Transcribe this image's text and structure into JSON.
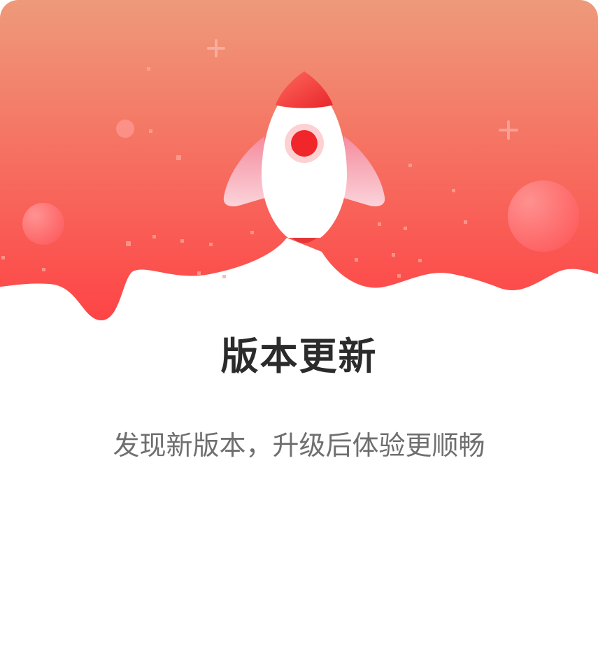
{
  "dialog": {
    "title": "版本更新",
    "message": "发现新版本，升级后体验更顺畅"
  },
  "hero": {
    "illustration": "rocket-icon",
    "colors": {
      "gradient_top": "#EE9A7A",
      "gradient_bottom": "#FE4446",
      "rocket_body": "#FFFFFF",
      "rocket_accent": "#F03A3A",
      "fin": "#F7A3B0"
    }
  }
}
